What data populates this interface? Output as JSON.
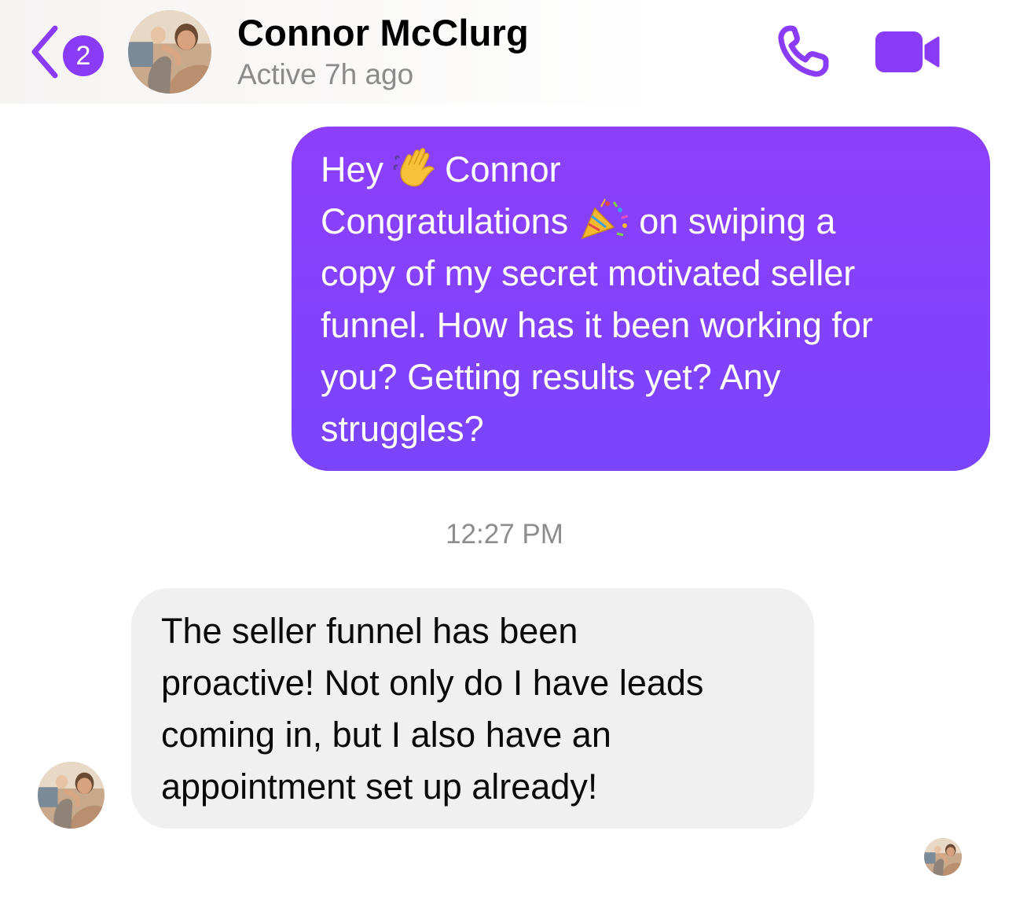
{
  "header": {
    "unread_count": "2",
    "contact_name": "Connor McClurg",
    "active_status": "Active 7h ago",
    "icons": {
      "back": "chevron-left-icon",
      "call": "phone-icon",
      "video": "video-camera-icon"
    }
  },
  "messages": [
    {
      "direction": "outgoing",
      "lines": [
        {
          "before": "Hey",
          "emoji": "waving-hand",
          "after": "Connor"
        },
        {
          "before": "Congratulations",
          "emoji": "party-popper",
          "after": "on swiping a"
        },
        {
          "text": "copy of my secret motivated seller"
        },
        {
          "text": "funnel. How has it been working for"
        },
        {
          "text": "you? Getting results yet? Any"
        },
        {
          "text": "struggles?"
        }
      ]
    },
    {
      "direction": "incoming",
      "lines": [
        {
          "text": "The seller funnel has been"
        },
        {
          "text": "proactive! Not only do I have leads"
        },
        {
          "text": "coming in, but I also have an"
        },
        {
          "text": "appointment set up already!"
        }
      ]
    }
  ],
  "timestamp": "12:27 PM",
  "colors": {
    "accent": "#8a3bf6",
    "outgoing_bubble": "#8a40fb",
    "incoming_bubble": "#f0f0f0",
    "secondary_text": "#8b8b8b"
  }
}
